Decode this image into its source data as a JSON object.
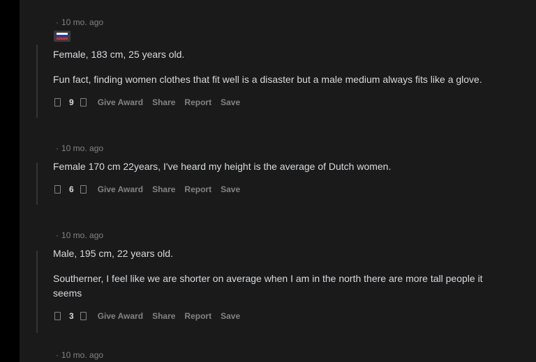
{
  "comments": [
    {
      "time": "10 mo. ago",
      "has_flair": true,
      "flair_colors": [
        "#ffffff",
        "#1f3f9e",
        "#d52b1e"
      ],
      "paragraphs": [
        "Female, 183 cm, 25 years old.",
        "Fun fact, finding women clothes that fit well is a disaster but a male medium always fits like a glove."
      ],
      "score": "9"
    },
    {
      "time": "10 mo. ago",
      "has_flair": false,
      "paragraphs": [
        "Female 170 cm 22years, I've heard my height is the average of Dutch women."
      ],
      "score": "6"
    },
    {
      "time": "10 mo. ago",
      "has_flair": false,
      "paragraphs": [
        "Male, 195 cm, 22 years old.",
        "Southerner, I feel like we are shorter on average when I am in the north there are more tall people it",
        "seems"
      ],
      "score": "3"
    },
    {
      "time": "10 mo. ago",
      "has_flair": false,
      "paragraphs": [],
      "score": ""
    }
  ],
  "actions": {
    "separator": "·",
    "give_award": "Give Award",
    "share": "Share",
    "report": "Report",
    "save": "Save"
  },
  "icons": {
    "upvote": "upvote-icon",
    "downvote": "downvote-icon"
  },
  "colors": {
    "background": "#1a1a1b",
    "text": "#d7dadc",
    "muted": "#818384",
    "thread_line": "#343536"
  }
}
